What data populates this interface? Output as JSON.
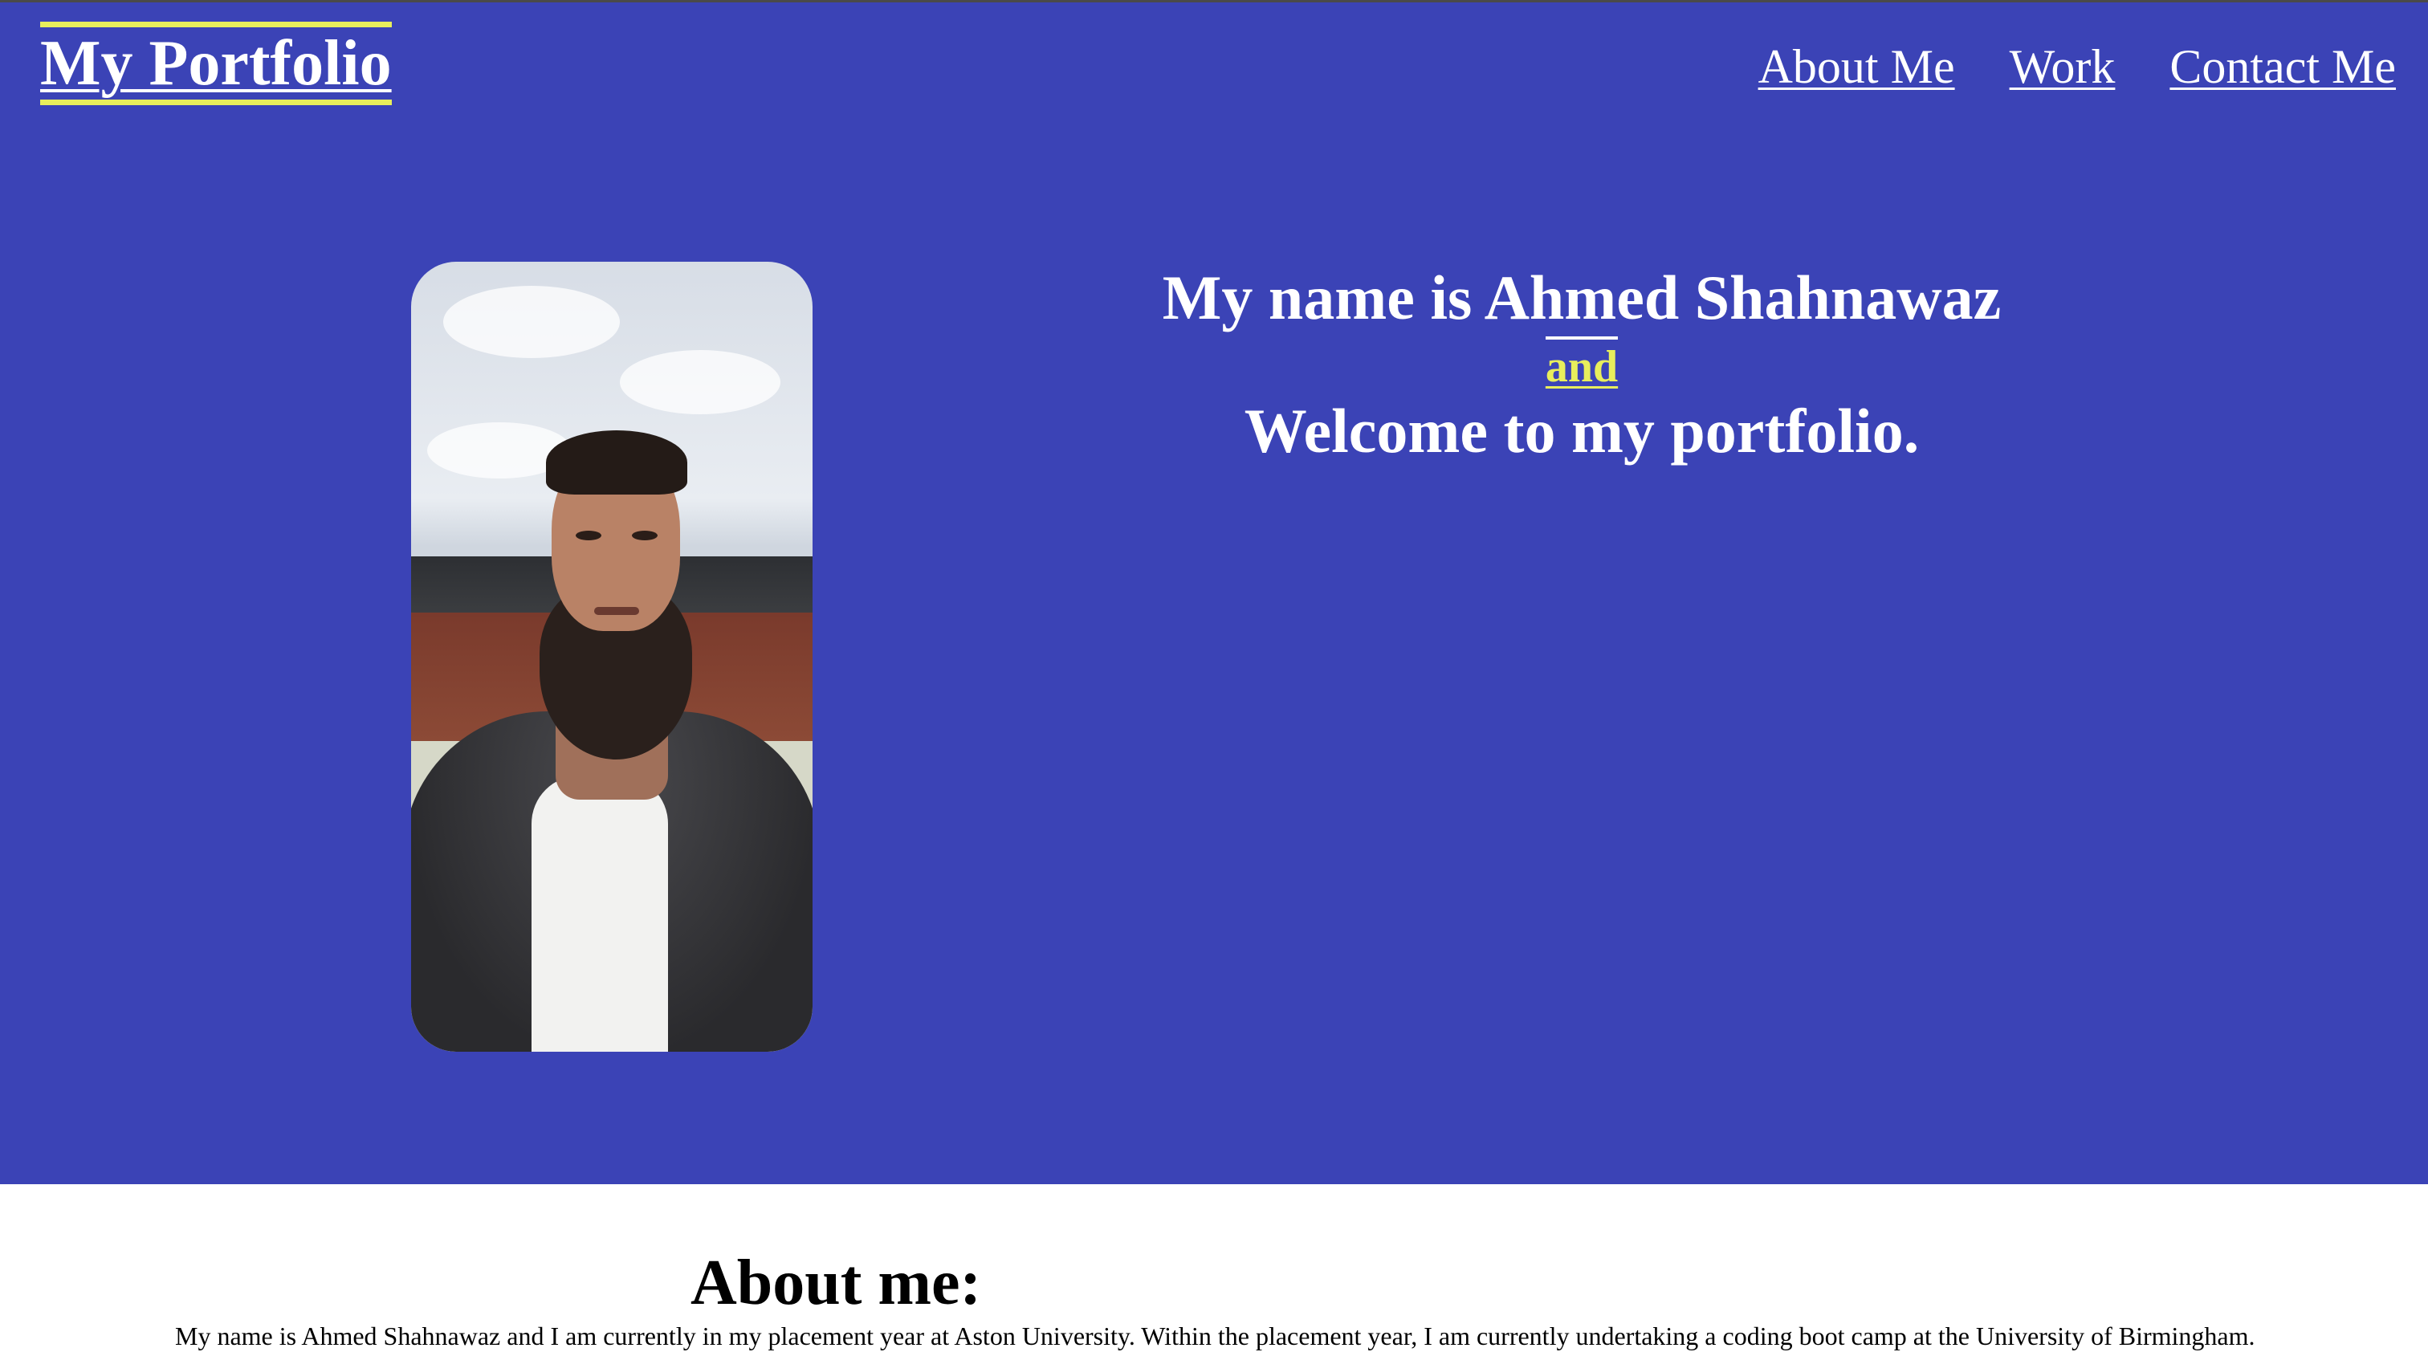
{
  "header": {
    "brand": "My Portfolio",
    "nav": [
      {
        "label": "About Me"
      },
      {
        "label": "Work"
      },
      {
        "label": "Contact Me"
      }
    ]
  },
  "hero": {
    "line1": "My name is Ahmed Shahnawaz",
    "and": "and",
    "line3": "Welcome to my portfolio."
  },
  "about": {
    "title": "About me:",
    "text": "My name is Ahmed Shahnawaz and I am currently in my placement year at Aston University. Within the placement year, I am currently undertaking a coding boot camp at the University of Birmingham."
  },
  "colors": {
    "hero_background": "#3b43b6",
    "accent": "#e8ee5c",
    "text_on_hero": "#ffffff"
  },
  "icons": {}
}
